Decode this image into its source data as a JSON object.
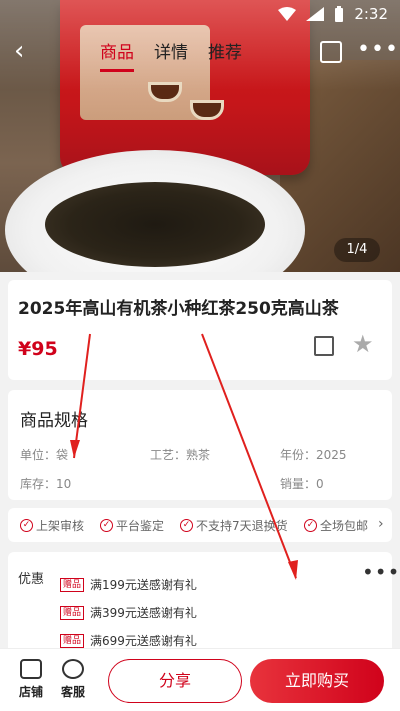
{
  "status_bar": {
    "time": "2:32"
  },
  "nav": {
    "back_icon": "chevron-left-icon",
    "tabs": [
      {
        "label": "商品",
        "active": true
      },
      {
        "label": "详情",
        "active": false
      },
      {
        "label": "推荐",
        "active": false
      }
    ],
    "share_icon": "share-icon",
    "more_icon": "more-icon"
  },
  "gallery": {
    "pager": "1/4"
  },
  "product": {
    "title": "2025年高山有机茶小种红茶250克高山茶",
    "price": "¥95"
  },
  "specs": {
    "heading": "商品规格",
    "rows": [
      [
        "单位：袋",
        "工艺：熟茶",
        "年份：2025"
      ],
      [
        "库存：10",
        "",
        "销量：0"
      ]
    ]
  },
  "assurances": [
    "上架审核",
    "平台鉴定",
    "不支持7天退换货",
    "全场包邮"
  ],
  "promotions": {
    "label": "优惠",
    "tag": "赠品",
    "items": [
      "满199元送感谢有礼",
      "满399元送感谢有礼",
      "满699元送感谢有礼"
    ]
  },
  "bottom_bar": {
    "store_label": "店铺",
    "service_label": "客服",
    "share_label": "分享",
    "buy_label": "立即购买"
  },
  "colors": {
    "accent": "#d0021b",
    "annotation": "#e0201e"
  }
}
